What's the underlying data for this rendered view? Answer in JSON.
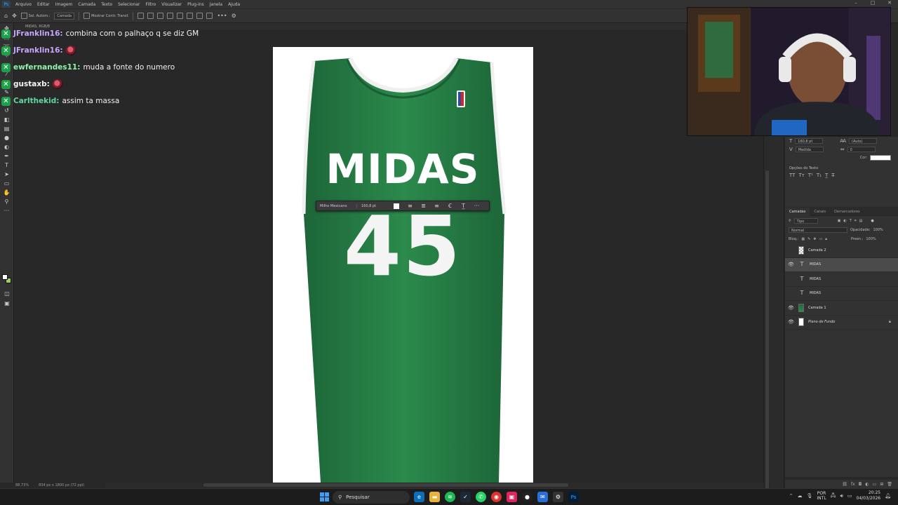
{
  "menubar": {
    "app_logo": "Ps",
    "items": [
      "Arquivo",
      "Editar",
      "Imagem",
      "Camada",
      "Texto",
      "Selecionar",
      "Filtro",
      "Visualizar",
      "Plug-ins",
      "Janela",
      "Ajuda"
    ]
  },
  "options_bar": {
    "auto_select_label": "Sel. Autom.:",
    "auto_select_target": "Camada",
    "show_transform": "Mostrar Contr. Transf."
  },
  "document_tab": "MIDAS, RGB/8",
  "chat": [
    {
      "user": "JFranklin16",
      "color": "#c7a6ff",
      "message": "combina com o palhaço q se diz GM",
      "emote": false
    },
    {
      "user": "JFranklin16",
      "color": "#c7a6ff",
      "message": "",
      "emote": true
    },
    {
      "user": "ewfernandes11",
      "color": "#8ef5a8",
      "message": "muda a fonte do numero",
      "emote": false
    },
    {
      "user": "gustaxb",
      "color": "#f4f4f4",
      "message": "",
      "emote": true
    },
    {
      "user": "Carlthekid",
      "color": "#60d9a1",
      "message": "assim ta massa",
      "emote": false
    }
  ],
  "canvas": {
    "jersey_name": "MIDAS",
    "jersey_number": "45",
    "jersey_color": "#237a43"
  },
  "text_float_toolbar": {
    "font": "Milho Mexicano",
    "size": "160,8 pt"
  },
  "status_bar": {
    "zoom": "88,73%",
    "doc_info": "834 px x 1800 px (72 ppi)"
  },
  "character_panel": {
    "size": "160,8 pt",
    "leading": "(Auto)",
    "kerning": "Medida",
    "tracking": "0",
    "color_label": "Cor:",
    "text_options_title": "Opções do Texto"
  },
  "layers_panel": {
    "tabs": [
      "Camadas",
      "Canais",
      "Demarcadores"
    ],
    "filter": "Tipo",
    "blend_mode": "Normal",
    "opacity_label": "Opacidade:",
    "opacity": "100%",
    "lock_label": "Bloq.:",
    "fill_label": "Preen.:",
    "fill": "100%",
    "layers": [
      {
        "name": "Camada 2",
        "type": "image",
        "thumb": "check",
        "visible": false,
        "selected": false,
        "italic": false,
        "locked": false
      },
      {
        "name": "MIDAS",
        "type": "text",
        "visible": true,
        "selected": true,
        "italic": false,
        "locked": false
      },
      {
        "name": "MIDAS",
        "type": "text",
        "visible": false,
        "selected": false,
        "italic": false,
        "locked": false
      },
      {
        "name": "MIDAS",
        "type": "text",
        "visible": false,
        "selected": false,
        "italic": false,
        "locked": false
      },
      {
        "name": "Camada 1",
        "type": "image",
        "thumb": "green",
        "visible": true,
        "selected": false,
        "italic": false,
        "locked": false
      },
      {
        "name": "Plano de Fundo",
        "type": "image",
        "thumb": "white",
        "visible": true,
        "selected": false,
        "italic": true,
        "locked": true
      }
    ]
  },
  "taskbar": {
    "search_placeholder": "Pesquisar",
    "language": "POR",
    "keyboard": "INTL",
    "time": "20:25",
    "date": "04/03/2026"
  },
  "colors": {
    "accent": "#31a8ff",
    "chat_badge": "#1ea04b",
    "foreground_swatch": "#ffffff",
    "background_swatch": "#9bd44b"
  }
}
